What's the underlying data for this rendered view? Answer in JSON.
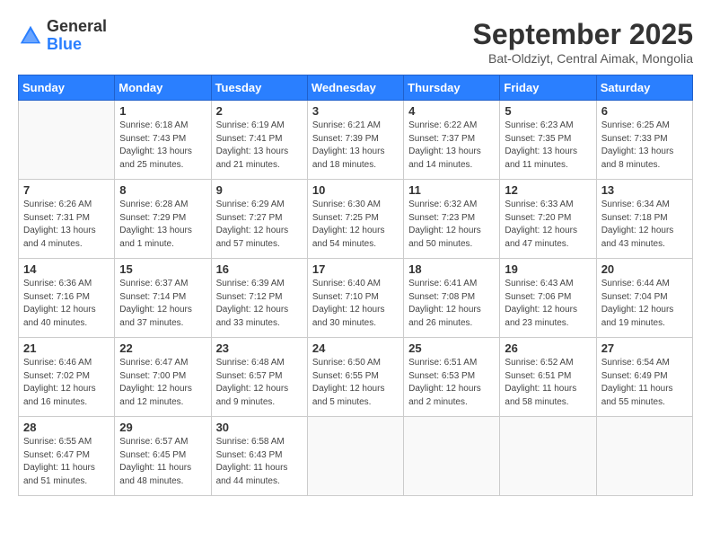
{
  "header": {
    "logo": {
      "general": "General",
      "blue": "Blue",
      "icon_alt": "GeneralBlue logo"
    },
    "month": "September 2025",
    "location": "Bat-Oldziyt, Central Aimak, Mongolia"
  },
  "weekdays": [
    "Sunday",
    "Monday",
    "Tuesday",
    "Wednesday",
    "Thursday",
    "Friday",
    "Saturday"
  ],
  "weeks": [
    [
      {
        "day": "",
        "info": ""
      },
      {
        "day": "1",
        "info": "Sunrise: 6:18 AM\nSunset: 7:43 PM\nDaylight: 13 hours\nand 25 minutes."
      },
      {
        "day": "2",
        "info": "Sunrise: 6:19 AM\nSunset: 7:41 PM\nDaylight: 13 hours\nand 21 minutes."
      },
      {
        "day": "3",
        "info": "Sunrise: 6:21 AM\nSunset: 7:39 PM\nDaylight: 13 hours\nand 18 minutes."
      },
      {
        "day": "4",
        "info": "Sunrise: 6:22 AM\nSunset: 7:37 PM\nDaylight: 13 hours\nand 14 minutes."
      },
      {
        "day": "5",
        "info": "Sunrise: 6:23 AM\nSunset: 7:35 PM\nDaylight: 13 hours\nand 11 minutes."
      },
      {
        "day": "6",
        "info": "Sunrise: 6:25 AM\nSunset: 7:33 PM\nDaylight: 13 hours\nand 8 minutes."
      }
    ],
    [
      {
        "day": "7",
        "info": "Sunrise: 6:26 AM\nSunset: 7:31 PM\nDaylight: 13 hours\nand 4 minutes."
      },
      {
        "day": "8",
        "info": "Sunrise: 6:28 AM\nSunset: 7:29 PM\nDaylight: 13 hours\nand 1 minute."
      },
      {
        "day": "9",
        "info": "Sunrise: 6:29 AM\nSunset: 7:27 PM\nDaylight: 12 hours\nand 57 minutes."
      },
      {
        "day": "10",
        "info": "Sunrise: 6:30 AM\nSunset: 7:25 PM\nDaylight: 12 hours\nand 54 minutes."
      },
      {
        "day": "11",
        "info": "Sunrise: 6:32 AM\nSunset: 7:23 PM\nDaylight: 12 hours\nand 50 minutes."
      },
      {
        "day": "12",
        "info": "Sunrise: 6:33 AM\nSunset: 7:20 PM\nDaylight: 12 hours\nand 47 minutes."
      },
      {
        "day": "13",
        "info": "Sunrise: 6:34 AM\nSunset: 7:18 PM\nDaylight: 12 hours\nand 43 minutes."
      }
    ],
    [
      {
        "day": "14",
        "info": "Sunrise: 6:36 AM\nSunset: 7:16 PM\nDaylight: 12 hours\nand 40 minutes."
      },
      {
        "day": "15",
        "info": "Sunrise: 6:37 AM\nSunset: 7:14 PM\nDaylight: 12 hours\nand 37 minutes."
      },
      {
        "day": "16",
        "info": "Sunrise: 6:39 AM\nSunset: 7:12 PM\nDaylight: 12 hours\nand 33 minutes."
      },
      {
        "day": "17",
        "info": "Sunrise: 6:40 AM\nSunset: 7:10 PM\nDaylight: 12 hours\nand 30 minutes."
      },
      {
        "day": "18",
        "info": "Sunrise: 6:41 AM\nSunset: 7:08 PM\nDaylight: 12 hours\nand 26 minutes."
      },
      {
        "day": "19",
        "info": "Sunrise: 6:43 AM\nSunset: 7:06 PM\nDaylight: 12 hours\nand 23 minutes."
      },
      {
        "day": "20",
        "info": "Sunrise: 6:44 AM\nSunset: 7:04 PM\nDaylight: 12 hours\nand 19 minutes."
      }
    ],
    [
      {
        "day": "21",
        "info": "Sunrise: 6:46 AM\nSunset: 7:02 PM\nDaylight: 12 hours\nand 16 minutes."
      },
      {
        "day": "22",
        "info": "Sunrise: 6:47 AM\nSunset: 7:00 PM\nDaylight: 12 hours\nand 12 minutes."
      },
      {
        "day": "23",
        "info": "Sunrise: 6:48 AM\nSunset: 6:57 PM\nDaylight: 12 hours\nand 9 minutes."
      },
      {
        "day": "24",
        "info": "Sunrise: 6:50 AM\nSunset: 6:55 PM\nDaylight: 12 hours\nand 5 minutes."
      },
      {
        "day": "25",
        "info": "Sunrise: 6:51 AM\nSunset: 6:53 PM\nDaylight: 12 hours\nand 2 minutes."
      },
      {
        "day": "26",
        "info": "Sunrise: 6:52 AM\nSunset: 6:51 PM\nDaylight: 11 hours\nand 58 minutes."
      },
      {
        "day": "27",
        "info": "Sunrise: 6:54 AM\nSunset: 6:49 PM\nDaylight: 11 hours\nand 55 minutes."
      }
    ],
    [
      {
        "day": "28",
        "info": "Sunrise: 6:55 AM\nSunset: 6:47 PM\nDaylight: 11 hours\nand 51 minutes."
      },
      {
        "day": "29",
        "info": "Sunrise: 6:57 AM\nSunset: 6:45 PM\nDaylight: 11 hours\nand 48 minutes."
      },
      {
        "day": "30",
        "info": "Sunrise: 6:58 AM\nSunset: 6:43 PM\nDaylight: 11 hours\nand 44 minutes."
      },
      {
        "day": "",
        "info": ""
      },
      {
        "day": "",
        "info": ""
      },
      {
        "day": "",
        "info": ""
      },
      {
        "day": "",
        "info": ""
      }
    ]
  ]
}
